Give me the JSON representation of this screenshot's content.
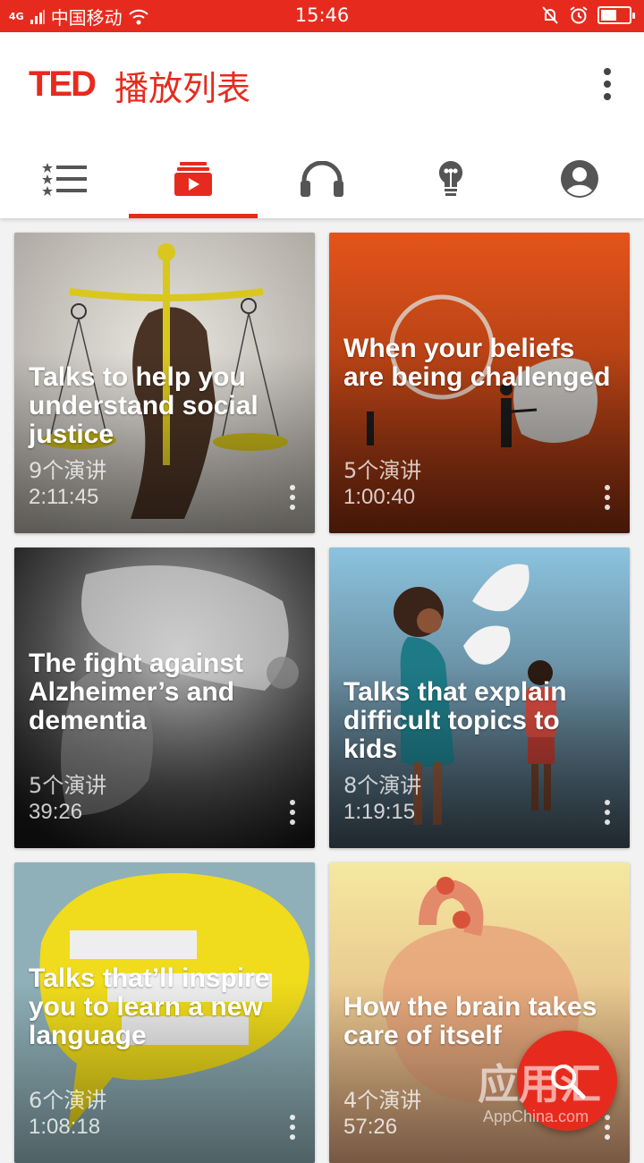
{
  "status_bar": {
    "network": "4G",
    "carrier": "中国移动",
    "time": "15:46",
    "battery_level": 0.55
  },
  "app_bar": {
    "logo": "TED",
    "title": "播放列表",
    "more_icon": "more-vert-icon"
  },
  "tabs": [
    {
      "icon": "ranked-list-icon",
      "active": false
    },
    {
      "icon": "playlist-icon",
      "active": true
    },
    {
      "icon": "headphones-icon",
      "active": false
    },
    {
      "icon": "lightbulb-icon",
      "active": false
    },
    {
      "icon": "account-icon",
      "active": false
    }
  ],
  "playlists": [
    {
      "title": "Talks to help you understand social justice",
      "count": "9个演讲",
      "duration": "2:11:45"
    },
    {
      "title": "When your beliefs are being challenged",
      "count": "5个演讲",
      "duration": "1:00:40"
    },
    {
      "title": "The fight against Alzheimer’s and dementia",
      "count": "5个演讲",
      "duration": "39:26"
    },
    {
      "title": "Talks that explain difficult topics to kids",
      "count": "8个演讲",
      "duration": "1:19:15"
    },
    {
      "title": "Talks that’ll inspire you to learn a new language",
      "count": "6个演讲",
      "duration": "1:08:18"
    },
    {
      "title": "How the brain takes care of itself",
      "count": "4个演讲",
      "duration": "57:26"
    }
  ],
  "fab": {
    "icon": "search-icon"
  },
  "watermark": {
    "text": "应用汇",
    "sub": "AppChina.com"
  },
  "colors": {
    "accent": "#e62b1e",
    "surface": "#ffffff",
    "background": "#f2f2f2"
  }
}
